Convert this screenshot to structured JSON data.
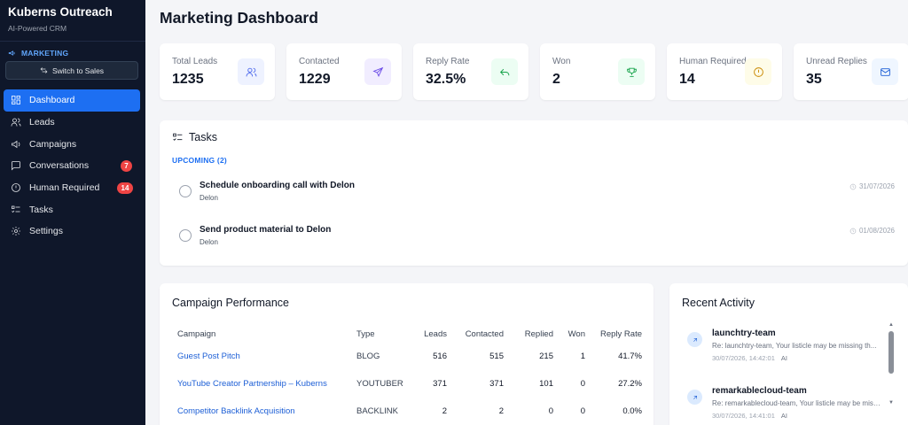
{
  "brand": {
    "title": "Kuberns Outreach",
    "subtitle": "AI-Powered CRM"
  },
  "section": {
    "label": "MARKETING",
    "switch_label": "Switch to Sales"
  },
  "nav": [
    {
      "label": "Dashboard",
      "icon": "dashboard-icon",
      "active": true
    },
    {
      "label": "Leads",
      "icon": "users-icon"
    },
    {
      "label": "Campaigns",
      "icon": "megaphone-icon"
    },
    {
      "label": "Conversations",
      "icon": "chat-icon",
      "badge": "7"
    },
    {
      "label": "Human Required",
      "icon": "alert-icon",
      "badge": "14"
    },
    {
      "label": "Tasks",
      "icon": "tasks-icon"
    },
    {
      "label": "Settings",
      "icon": "gear-icon"
    }
  ],
  "page": {
    "title": "Marketing Dashboard"
  },
  "stats": [
    {
      "label": "Total Leads",
      "value": "1235",
      "icon": "users-icon",
      "color": "#4f6bed",
      "bg": "#eef2ff"
    },
    {
      "label": "Contacted",
      "value": "1229",
      "icon": "send-icon",
      "color": "#6d4de8",
      "bg": "#f1edff"
    },
    {
      "label": "Reply Rate",
      "value": "32.5%",
      "icon": "reply-icon",
      "color": "#16a34a",
      "bg": "#ecfdf3"
    },
    {
      "label": "Won",
      "value": "2",
      "icon": "trophy-icon",
      "color": "#16a34a",
      "bg": "#ecfdf3"
    },
    {
      "label": "Human Required",
      "value": "14",
      "icon": "alert-icon",
      "color": "#ca8a04",
      "bg": "#fefce8"
    },
    {
      "label": "Unread Replies",
      "value": "35",
      "icon": "mail-icon",
      "color": "#1d5fd6",
      "bg": "#eff6ff"
    }
  ],
  "tasks": {
    "title": "Tasks",
    "upcoming_label": "UPCOMING (2)",
    "items": [
      {
        "title": "Schedule onboarding call with Delon",
        "sub": "Delon",
        "date": "31/07/2026"
      },
      {
        "title": "Send product material to Delon",
        "sub": "Delon",
        "date": "01/08/2026"
      }
    ]
  },
  "campaigns": {
    "title": "Campaign Performance",
    "columns": [
      "Campaign",
      "Type",
      "Leads",
      "Contacted",
      "Replied",
      "Won",
      "Reply Rate"
    ],
    "rows": [
      {
        "name": "Guest Post Pitch",
        "type": "BLOG",
        "leads": "516",
        "contacted": "515",
        "replied": "215",
        "won": "1",
        "rate": "41.7%"
      },
      {
        "name": "YouTube Creator Partnership – Kuberns",
        "type": "YOUTUBER",
        "leads": "371",
        "contacted": "371",
        "replied": "101",
        "won": "0",
        "rate": "27.2%"
      },
      {
        "name": "Competitor Backlink Acquisition",
        "type": "BACKLINK",
        "leads": "2",
        "contacted": "2",
        "replied": "0",
        "won": "0",
        "rate": "0.0%"
      }
    ]
  },
  "activity": {
    "title": "Recent Activity",
    "items": [
      {
        "name": "launchtry-team",
        "desc": "Re: launchtry-team, Your listicle may be missing th...",
        "time": "30/07/2026, 14:42:01",
        "tag": "AI"
      },
      {
        "name": "remarkablecloud-team",
        "desc": "Re: remarkablecloud-team, Your listicle may be missi...",
        "time": "30/07/2026, 14:41:01",
        "tag": "AI"
      }
    ]
  }
}
